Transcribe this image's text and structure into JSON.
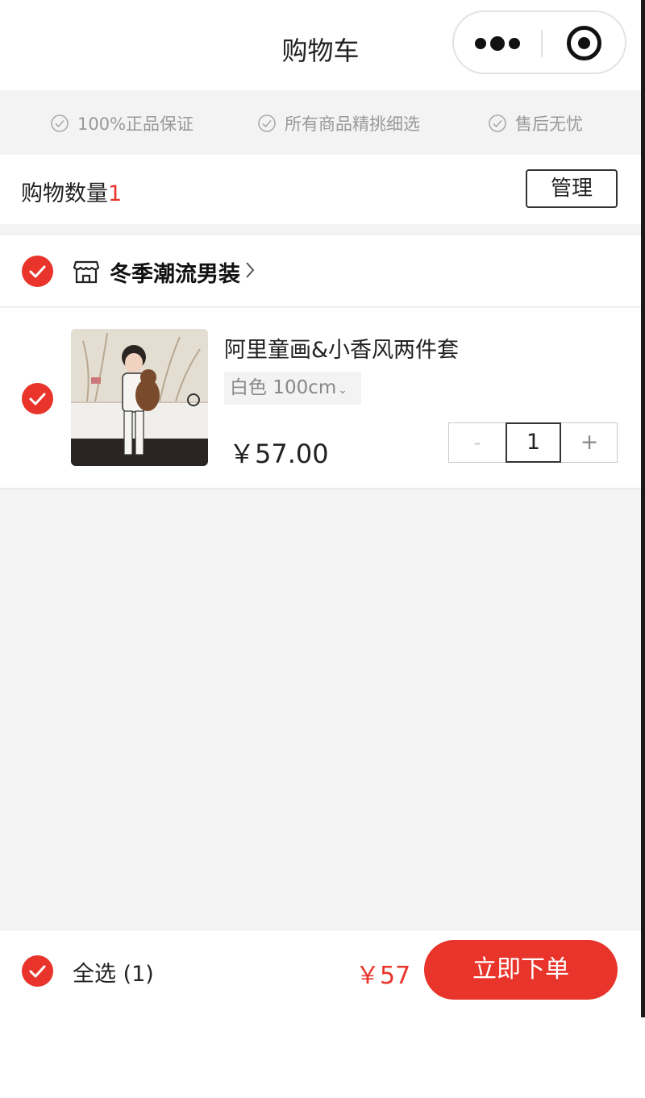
{
  "nav": {
    "title": "购物车"
  },
  "guarantees": [
    {
      "label": "100%正品保证"
    },
    {
      "label": "所有商品精挑细选"
    },
    {
      "label": "售后无忧"
    }
  ],
  "cart": {
    "count_label": "购物数量",
    "count": "1",
    "manage_label": "管理"
  },
  "store": {
    "name": "冬季潮流男装",
    "checked": true
  },
  "item": {
    "title": "阿里童画&小香风两件套",
    "spec": "白色 100cm",
    "price": "￥57.00",
    "quantity": "1",
    "minus": "-",
    "plus": "+",
    "checked": true
  },
  "footer": {
    "select_all": "全选 (1)",
    "total": "￥57",
    "order_button": "立即下单"
  },
  "colors": {
    "accent": "#e8342a",
    "background": "#f3f3f3"
  }
}
